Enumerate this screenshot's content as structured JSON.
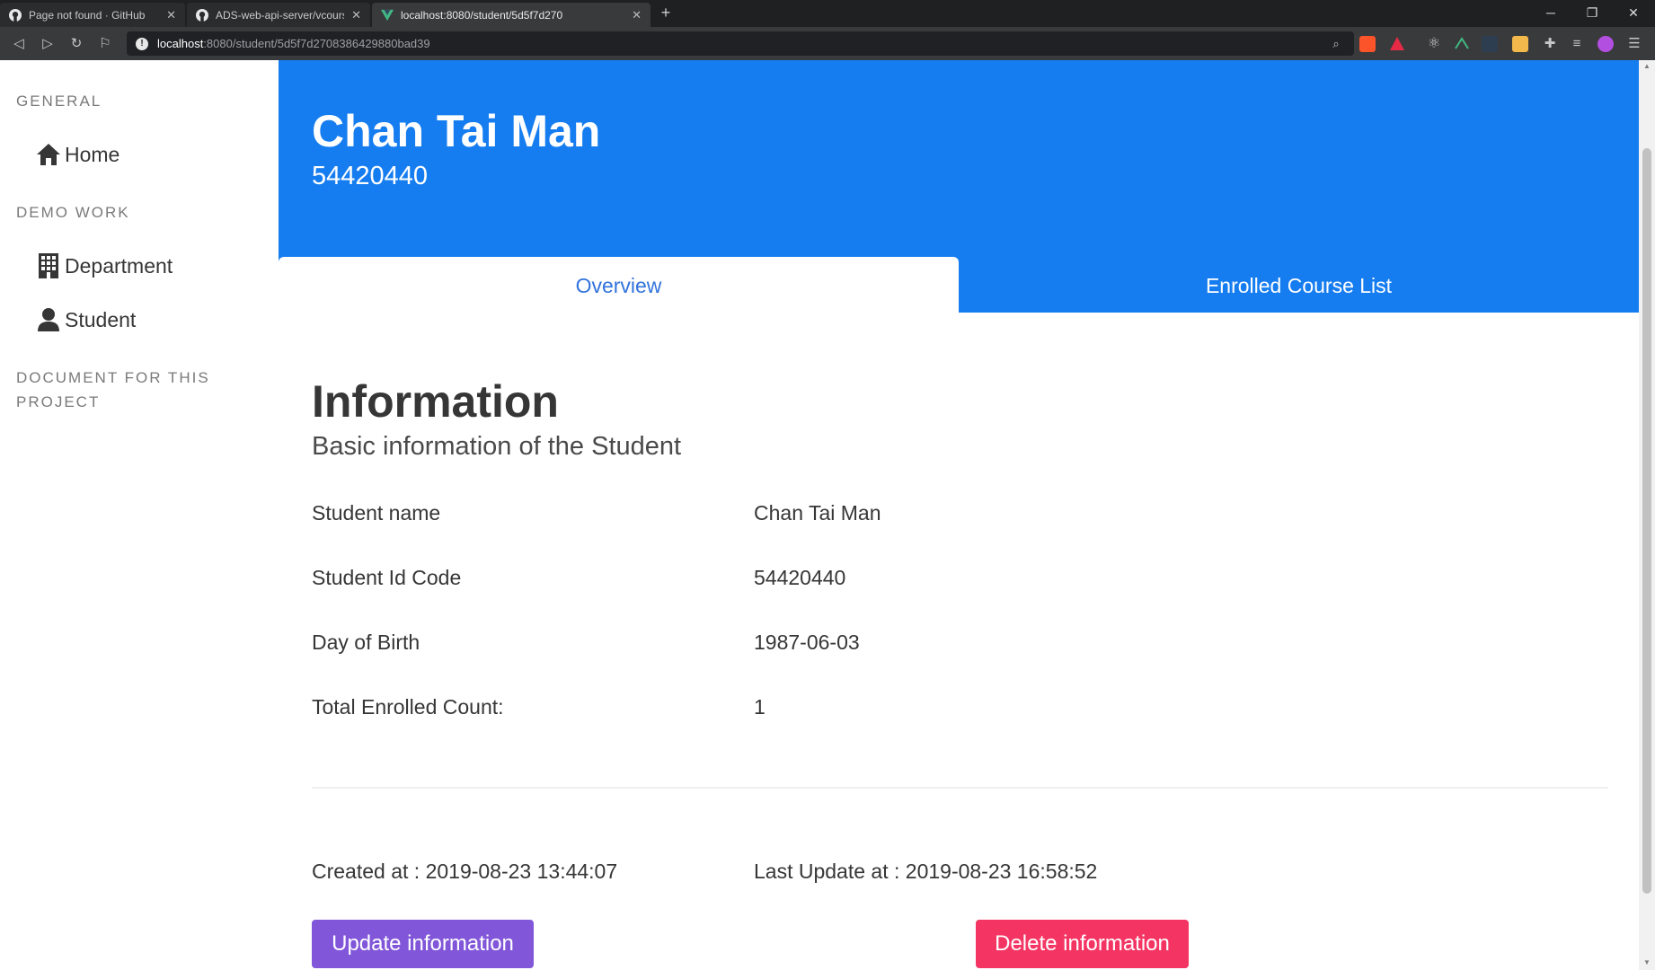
{
  "browser": {
    "tabs": [
      {
        "title": "Page not found · GitHub",
        "icon": "github-icon",
        "active": false
      },
      {
        "title": "ADS-web-api-server/vcourse.md a",
        "icon": "github-icon",
        "active": false
      },
      {
        "title": "localhost:8080/student/5d5f7d270",
        "icon": "vue-icon",
        "active": true
      }
    ],
    "url_host": "localhost",
    "url_path": ":8080/student/5d5f7d2708386429880bad39"
  },
  "sidebar": {
    "general_label": "GENERAL",
    "home_label": "Home",
    "demo_label": "DEMO WORK",
    "department_label": "Department",
    "student_label": "Student",
    "document_label": "DOCUMENT FOR THIS PROJECT"
  },
  "hero": {
    "name": "Chan Tai Man",
    "id": "54420440",
    "tabs": {
      "overview": "Overview",
      "enrolled": "Enrolled Course List"
    }
  },
  "info": {
    "title": "Information",
    "subtitle": "Basic information of the Student",
    "rows": [
      {
        "label": "Student name",
        "value": "Chan Tai Man"
      },
      {
        "label": "Student Id Code",
        "value": "54420440"
      },
      {
        "label": "Day of Birth",
        "value": "1987-06-03"
      },
      {
        "label": "Total Enrolled Count:",
        "value": "1"
      }
    ],
    "created": "Created at : 2019-08-23 13:44:07",
    "updated": "Last Update at : 2019-08-23 16:58:52",
    "update_button": "Update information",
    "delete_button": "Delete information"
  },
  "colors": {
    "hero_bg": "#167df0",
    "active_tab_text": "#3273dc",
    "update_button": "#8156d9",
    "delete_button": "#f43563"
  }
}
